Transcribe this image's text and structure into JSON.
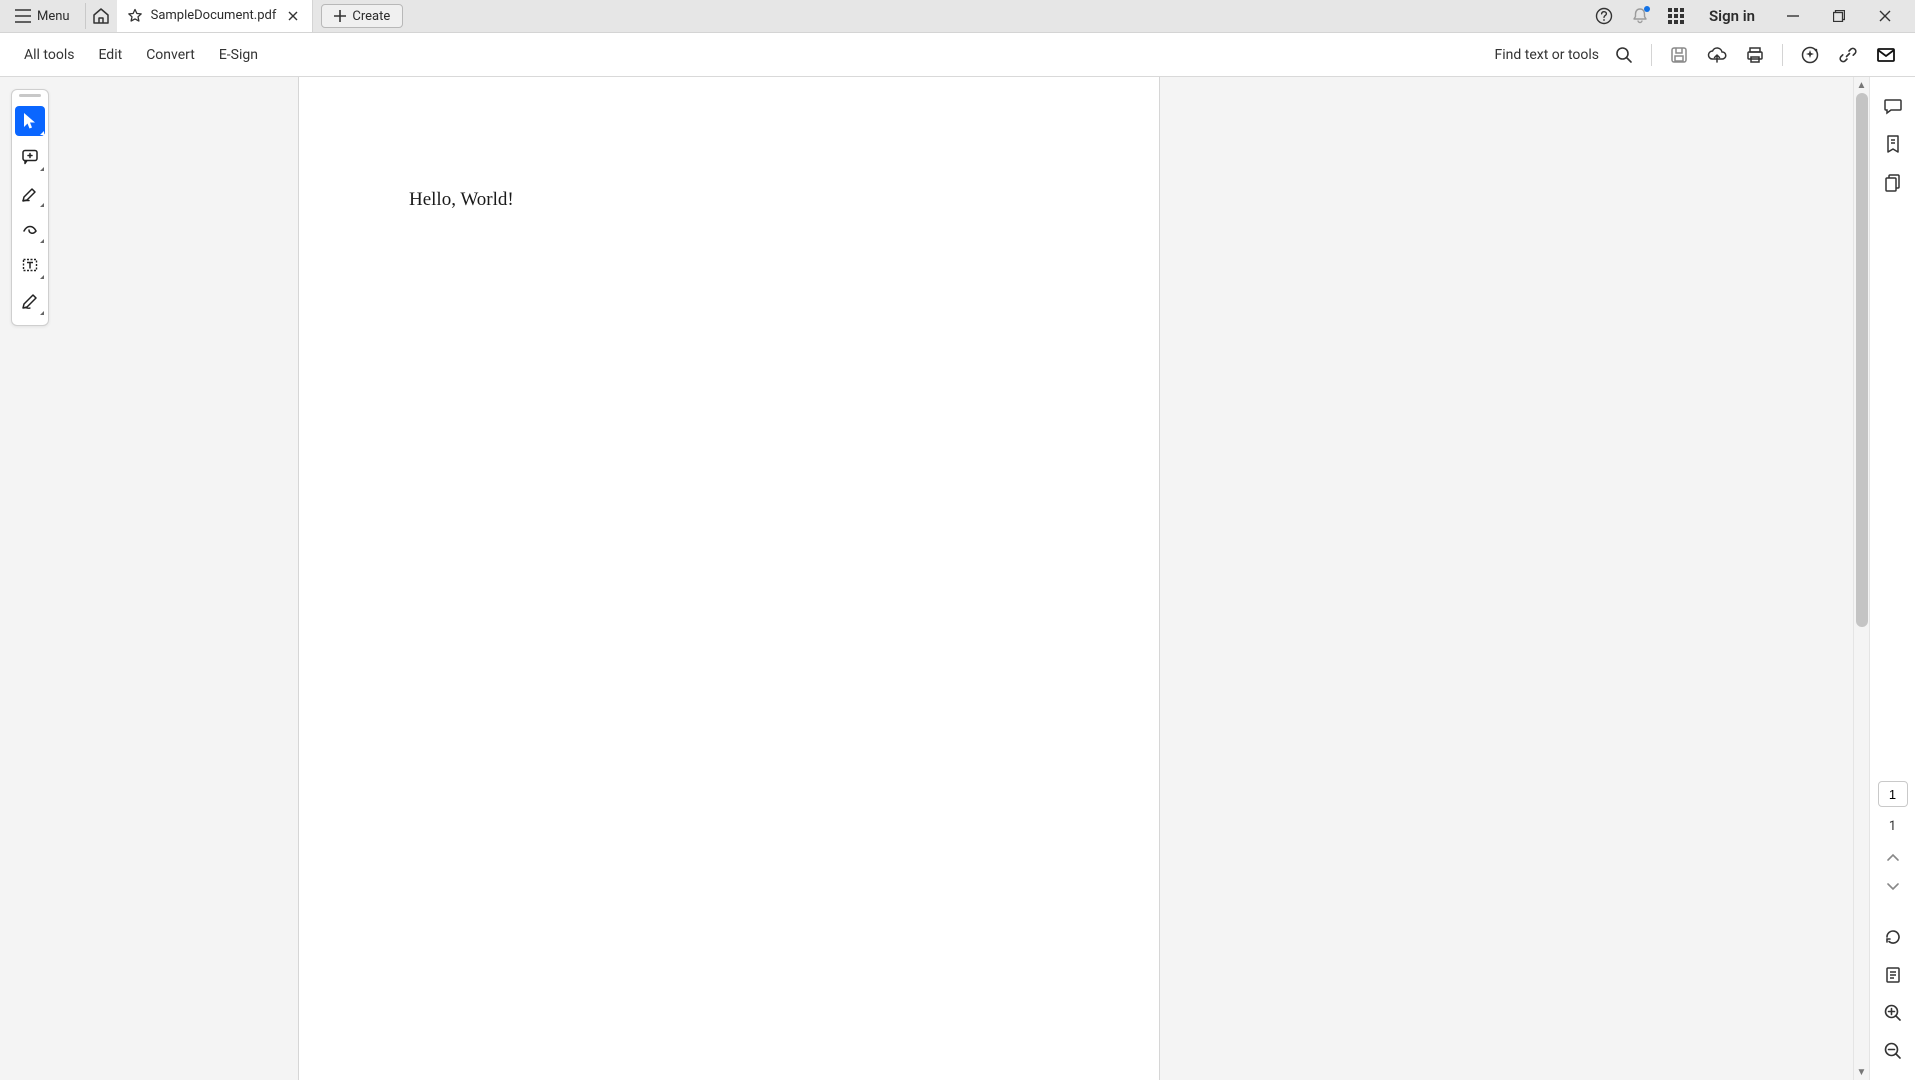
{
  "titlebar": {
    "menu_label": "Menu",
    "tab_title": "SampleDocument.pdf",
    "create_label": "Create",
    "signin_label": "Sign in"
  },
  "menubar": {
    "items": [
      "All tools",
      "Edit",
      "Convert",
      "E-Sign"
    ],
    "find_label": "Find text or tools"
  },
  "document": {
    "body_text": "Hello, World!"
  },
  "pagenav": {
    "current_page": "1",
    "total_pages": "1"
  }
}
